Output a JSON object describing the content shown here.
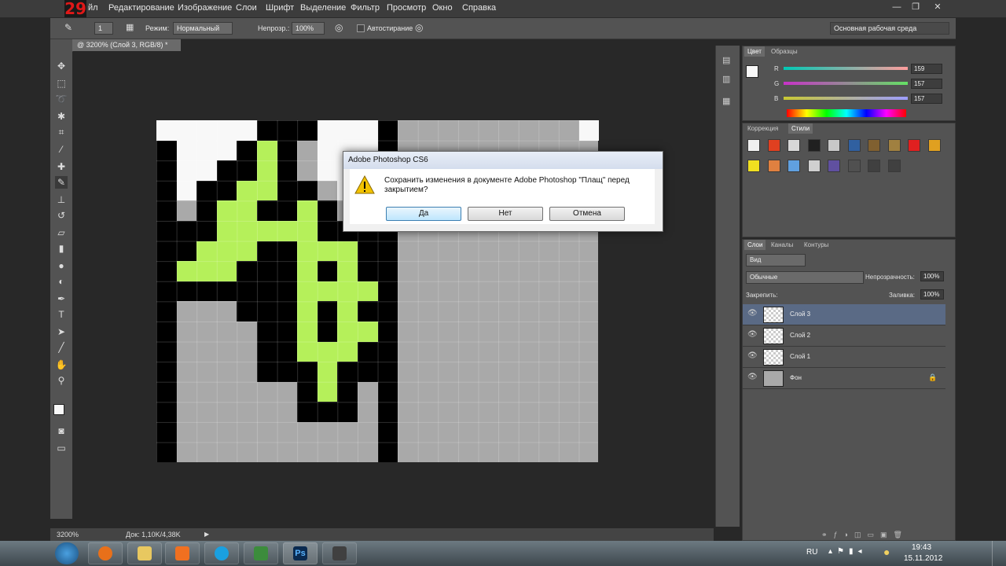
{
  "app": {
    "logo_text": "29"
  },
  "menu": [
    "йл",
    "Редактирование",
    "Изображение",
    "Слои",
    "Шрифт",
    "Выделение",
    "Фильтр",
    "Просмотр",
    "Окно",
    "Справка"
  ],
  "window_controls": {
    "minimize": "—",
    "restore": "❐",
    "close": "✕"
  },
  "options_bar": {
    "size": "1",
    "mode_label": "Режим:",
    "mode_value": "Нормальный",
    "opacity_label": "Непрозр.:",
    "opacity_value": "100%",
    "autoerase_label": "Автостирание",
    "workspace": "Основная рабочая среда"
  },
  "document": {
    "tab_label": "@ 3200% (Слой 3, RGB/8) *",
    "zoom": "3200%",
    "doc_info": "Док: 1,10K/4,38K",
    "colors": {
      "black": "#000000",
      "green": "#b5f05a",
      "white": "#f8f8f8",
      "gray": "#a9a9a9"
    }
  },
  "color_panel": {
    "tabs": [
      "Цвет",
      "Образцы"
    ],
    "channels": [
      {
        "label": "R",
        "value": "159"
      },
      {
        "label": "G",
        "value": "157"
      },
      {
        "label": "B",
        "value": "157"
      }
    ]
  },
  "styles_panel": {
    "tabs": [
      "Коррекция",
      "Стили"
    ]
  },
  "layers_panel": {
    "tabs": [
      "Слои",
      "Каналы",
      "Контуры"
    ],
    "filter_label": "Вид",
    "blend_mode": "Обычные",
    "opacity_label": "Непрозрачность:",
    "opacity_value": "100%",
    "lock_label": "Закрепить:",
    "fill_label": "Заливка:",
    "fill_value": "100%",
    "layers": [
      {
        "name": "Слой 3",
        "selected": true
      },
      {
        "name": "Слой 2",
        "selected": false
      },
      {
        "name": "Слой 1",
        "selected": false
      },
      {
        "name": "Фон",
        "selected": false
      }
    ]
  },
  "dialog": {
    "title": "Adobe Photoshop CS6",
    "message": "Сохранить изменения в документе Adobe Photoshop \"Плащ\" перед закрытием?",
    "buttons": {
      "yes": "Да",
      "no": "Нет",
      "cancel": "Отмена"
    }
  },
  "taskbar": {
    "language": "RU",
    "time": "19:43",
    "date": "15.11.2012",
    "ps_label": "Ps"
  }
}
